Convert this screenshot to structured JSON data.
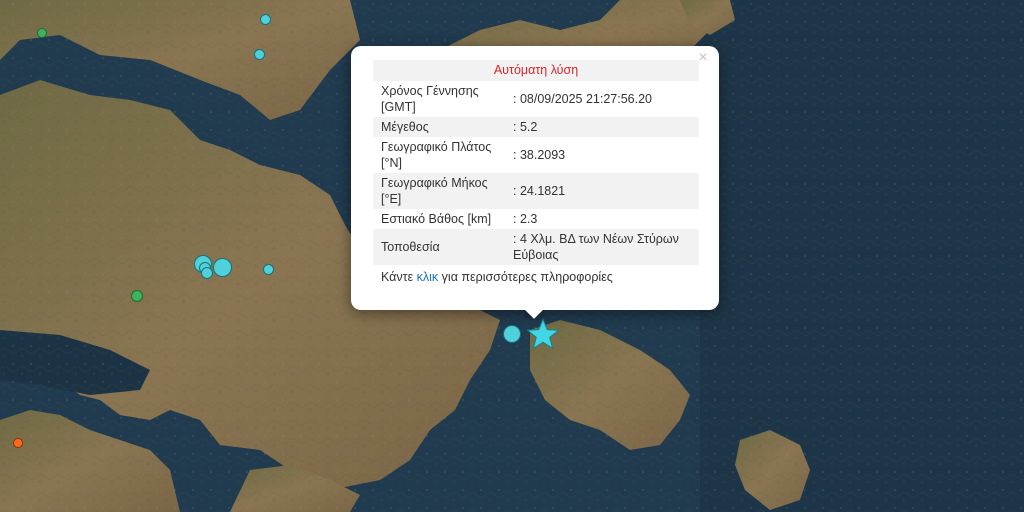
{
  "map": {
    "colors": {
      "sea": "#203a4f",
      "land": "#7b6a48",
      "accent": "#4fd0db"
    },
    "markers": [
      {
        "name": "event-marker",
        "color": "green"
      },
      {
        "name": "event-marker",
        "color": "cyan"
      },
      {
        "name": "event-marker",
        "color": "cyan"
      },
      {
        "name": "event-marker",
        "color": "cyan"
      },
      {
        "name": "event-marker",
        "color": "green"
      },
      {
        "name": "event-marker",
        "color": "orange"
      }
    ],
    "selected_icon": "star-icon"
  },
  "popup": {
    "title": "Αυτόματη λύση",
    "close_icon": "close-icon",
    "rows": [
      {
        "label": "Χρόνος Γέννησης [GMT]",
        "value": ": 08/09/2025 21:27:56.20"
      },
      {
        "label": "Μέγεθος",
        "value": ": 5.2"
      },
      {
        "label": "Γεωγραφικό Πλάτος [°N]",
        "value": ": 38.2093"
      },
      {
        "label": "Γεωγραφικό Μήκος [°E]",
        "value": ": 24.1821"
      },
      {
        "label": "Εστιακό Βάθος [km]",
        "value": ": 2.3"
      },
      {
        "label": "Τοποθεσία",
        "value": ": 4 Χλμ. ΒΔ των Νέων Στύρων Εύβοιας"
      }
    ],
    "footer": {
      "before": "Κάντε ",
      "link": "κλικ",
      "after": " για περισσότερες πληροφορίες"
    }
  }
}
